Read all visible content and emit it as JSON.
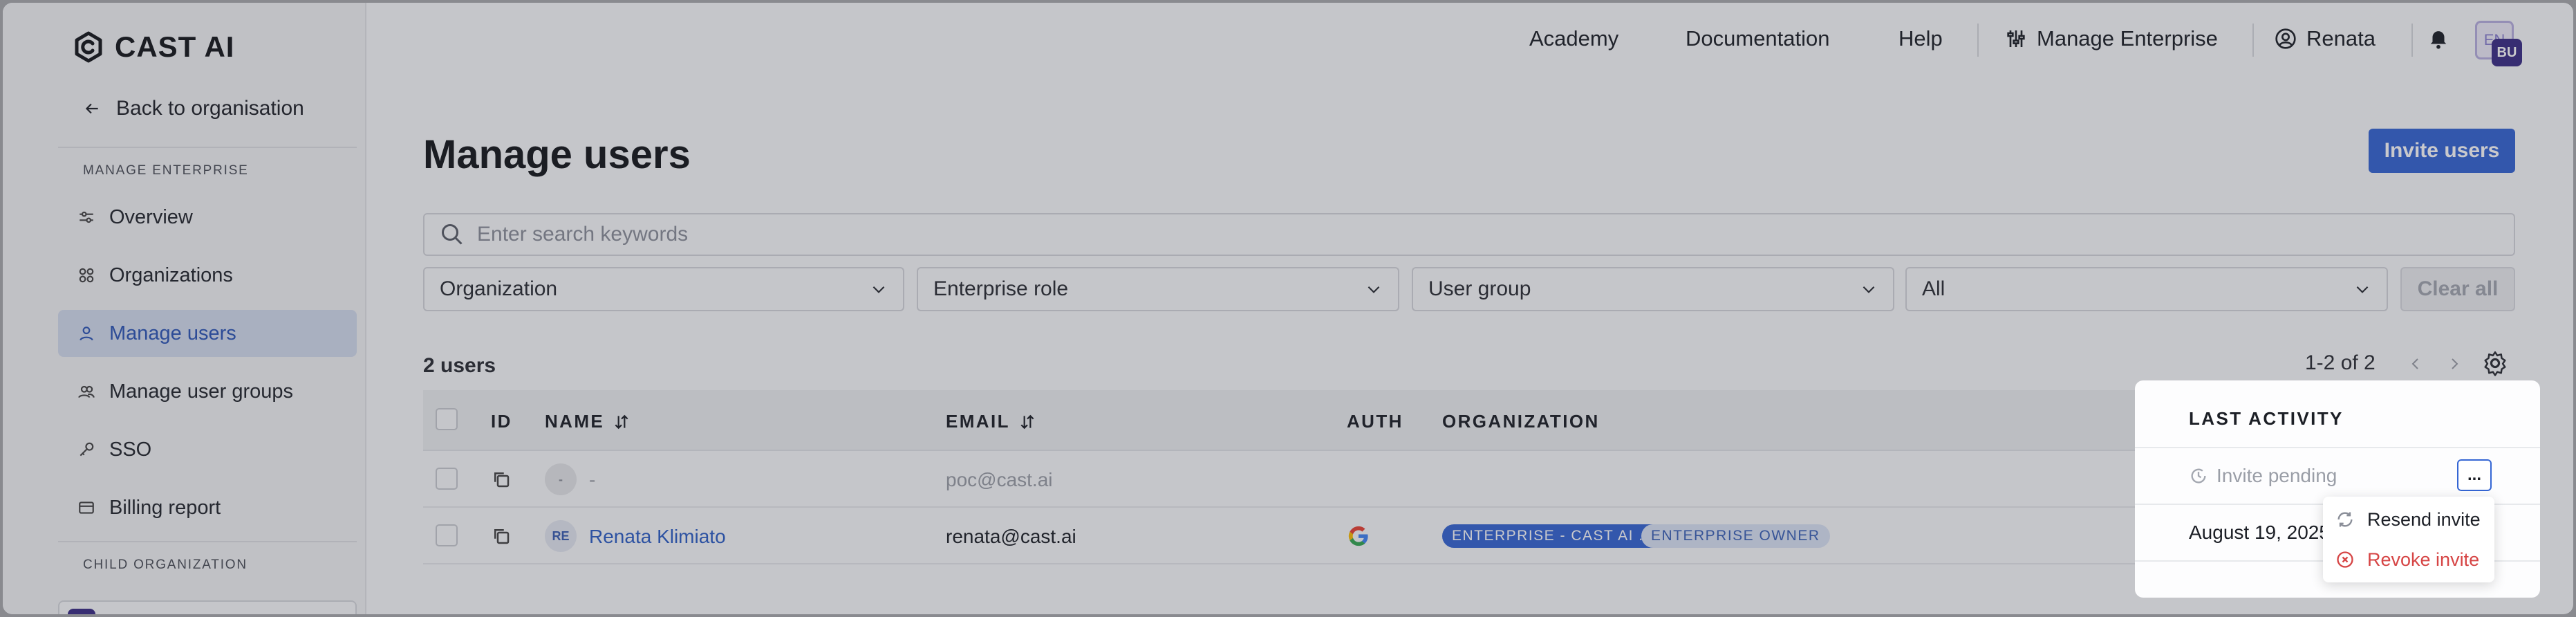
{
  "brand": {
    "name": "CAST AI"
  },
  "sidebar": {
    "back_label": "Back to organisation",
    "section_manage": "MANAGE ENTERPRISE",
    "items": [
      {
        "label": "Overview",
        "icon": "sliders-icon"
      },
      {
        "label": "Organizations",
        "icon": "grid-icon"
      },
      {
        "label": "Manage users",
        "icon": "user-icon",
        "active": true
      },
      {
        "label": "Manage user groups",
        "icon": "users-icon"
      },
      {
        "label": "SSO",
        "icon": "key-icon"
      },
      {
        "label": "Billing report",
        "icon": "card-icon"
      }
    ],
    "section_child": "CHILD ORGANIZATION"
  },
  "topbar": {
    "academy": "Academy",
    "documentation": "Documentation",
    "help": "Help",
    "manage_enterprise": "Manage Enterprise",
    "user_name": "Renata",
    "avatar_back": "EN",
    "avatar_front": "BU"
  },
  "main": {
    "title": "Manage users",
    "invite_button": "Invite users",
    "search_placeholder": "Enter search keywords",
    "filters": {
      "organization": "Organization",
      "enterprise_role": "Enterprise role",
      "user_group": "User group",
      "status": "All"
    },
    "clear_all": "Clear all",
    "count": "2 users",
    "pagination": "1-2 of 2"
  },
  "table": {
    "columns": {
      "id": "ID",
      "name": "NAME",
      "email": "EMAIL",
      "auth": "AUTH",
      "organization": "ORGANIZATION",
      "last_activity": "LAST ACTIVITY"
    },
    "rows": [
      {
        "avatar": "-",
        "name": "-",
        "email": "poc@cast.ai",
        "last_activity": "Invite pending"
      },
      {
        "avatar": "RE",
        "name": "Renata Klimiato",
        "email": "renata@cast.ai",
        "auth": "google",
        "tags": [
          "ENTERPRISE - CAST AI ...",
          "ENTERPRISE OWNER"
        ],
        "last_activity": "August 19, 2025"
      }
    ]
  },
  "row_menu": {
    "more_label": "...",
    "resend": "Resend invite",
    "revoke": "Revoke invite"
  },
  "colors": {
    "accent": "#3566d4",
    "danger": "#d64545",
    "sidebar_active_bg": "#d4deef"
  }
}
